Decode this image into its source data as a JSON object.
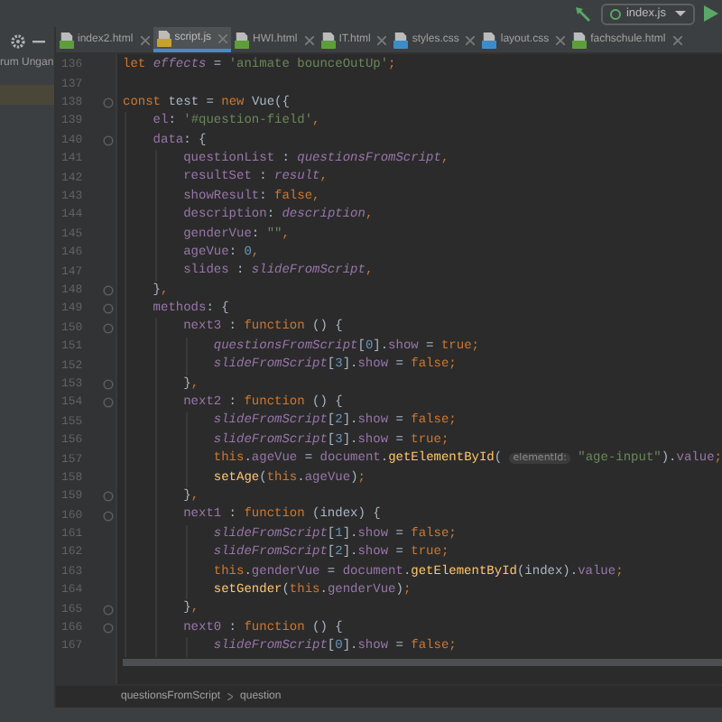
{
  "toolbar": {
    "run_config": "index.js"
  },
  "sidebar": {
    "rows": [
      {
        "label": "rum Ungan",
        "selected": false
      },
      {
        "selected": true
      }
    ]
  },
  "tabs": [
    {
      "label": "index2.html",
      "kind": "html",
      "selected": false
    },
    {
      "label": "script.js",
      "kind": "js",
      "selected": true
    },
    {
      "label": "HWI.html",
      "kind": "html",
      "selected": false
    },
    {
      "label": "IT.html",
      "kind": "html",
      "selected": false
    },
    {
      "label": "styles.css",
      "kind": "css",
      "selected": false
    },
    {
      "label": "layout.css",
      "kind": "css",
      "selected": false
    },
    {
      "label": "fachschule.html",
      "kind": "html",
      "selected": false
    }
  ],
  "editor": {
    "lines": [
      {
        "number": "136",
        "fold": false,
        "tokens": [
          {
            "kind": "kw",
            "text": "let "
          },
          {
            "kind": "gvar",
            "text": "effects"
          },
          {
            "kind": "plain",
            "text": " = "
          },
          {
            "kind": "str",
            "text": "'animate bounceOutUp'"
          },
          {
            "kind": "kw",
            "text": ";"
          }
        ]
      },
      {
        "number": "137",
        "fold": false
      },
      {
        "number": "138",
        "fold": true,
        "tokens": [
          {
            "kind": "kw",
            "text": "const "
          },
          {
            "kind": "plain",
            "text": "test = "
          },
          {
            "kind": "kw",
            "text": "new "
          },
          {
            "kind": "plain",
            "text": "Vue({"
          }
        ]
      },
      {
        "number": "139",
        "fold": false,
        "tokens": [
          {
            "kind": "field",
            "text": "    el"
          },
          {
            "kind": "plain",
            "text": ": "
          },
          {
            "kind": "str",
            "text": "'#question-field'"
          },
          {
            "kind": "kw",
            "text": ","
          }
        ]
      },
      {
        "number": "140",
        "fold": true,
        "tokens": [
          {
            "kind": "field",
            "text": "    data"
          },
          {
            "kind": "plain",
            "text": ": {"
          }
        ]
      },
      {
        "number": "141",
        "fold": false,
        "tokens": [
          {
            "kind": "field",
            "text": "        questionList"
          },
          {
            "kind": "plain",
            "text": " : "
          },
          {
            "kind": "gvar",
            "text": "questionsFromScript"
          },
          {
            "kind": "kw",
            "text": ","
          }
        ]
      },
      {
        "number": "142",
        "fold": false,
        "tokens": [
          {
            "kind": "field",
            "text": "        resultSet"
          },
          {
            "kind": "plain",
            "text": " : "
          },
          {
            "kind": "gvar",
            "text": "result"
          },
          {
            "kind": "kw",
            "text": ","
          }
        ]
      },
      {
        "number": "143",
        "fold": false,
        "tokens": [
          {
            "kind": "field",
            "text": "        showResult"
          },
          {
            "kind": "plain",
            "text": ": "
          },
          {
            "kind": "kw",
            "text": "false,"
          }
        ]
      },
      {
        "number": "144",
        "fold": false,
        "tokens": [
          {
            "kind": "field",
            "text": "        description"
          },
          {
            "kind": "plain",
            "text": ": "
          },
          {
            "kind": "gvar",
            "text": "description"
          },
          {
            "kind": "kw",
            "text": ","
          }
        ]
      },
      {
        "number": "145",
        "fold": false,
        "tokens": [
          {
            "kind": "field",
            "text": "        genderVue"
          },
          {
            "kind": "plain",
            "text": ": "
          },
          {
            "kind": "str",
            "text": "\"\""
          },
          {
            "kind": "kw",
            "text": ","
          }
        ]
      },
      {
        "number": "146",
        "fold": false,
        "tokens": [
          {
            "kind": "field",
            "text": "        ageVue"
          },
          {
            "kind": "plain",
            "text": ": "
          },
          {
            "kind": "num",
            "text": "0"
          },
          {
            "kind": "kw",
            "text": ","
          }
        ]
      },
      {
        "number": "147",
        "fold": false,
        "tokens": [
          {
            "kind": "field",
            "text": "        slides"
          },
          {
            "kind": "plain",
            "text": " : "
          },
          {
            "kind": "gvar",
            "text": "slideFromScript"
          },
          {
            "kind": "kw",
            "text": ","
          }
        ]
      },
      {
        "number": "148",
        "fold": true,
        "tokens": [
          {
            "kind": "plain",
            "text": "    }"
          },
          {
            "kind": "kw",
            "text": ","
          }
        ]
      },
      {
        "number": "149",
        "fold": true,
        "tokens": [
          {
            "kind": "field",
            "text": "    methods"
          },
          {
            "kind": "plain",
            "text": ": {"
          }
        ]
      },
      {
        "number": "150",
        "fold": true,
        "tokens": [
          {
            "kind": "field",
            "text": "        next3"
          },
          {
            "kind": "plain",
            "text": " : "
          },
          {
            "kind": "kw",
            "text": "function "
          },
          {
            "kind": "plain",
            "text": "() {"
          }
        ]
      },
      {
        "number": "151",
        "fold": false,
        "tokens": [
          {
            "kind": "gvar",
            "text": "            questionsFromScript"
          },
          {
            "kind": "plain",
            "text": "["
          },
          {
            "kind": "num",
            "text": "0"
          },
          {
            "kind": "plain",
            "text": "]."
          },
          {
            "kind": "field",
            "text": "show"
          },
          {
            "kind": "plain",
            "text": " = "
          },
          {
            "kind": "kw",
            "text": "true;"
          }
        ]
      },
      {
        "number": "152",
        "fold": false,
        "tokens": [
          {
            "kind": "gvar",
            "text": "            slideFromScript"
          },
          {
            "kind": "plain",
            "text": "["
          },
          {
            "kind": "num",
            "text": "3"
          },
          {
            "kind": "plain",
            "text": "]."
          },
          {
            "kind": "field",
            "text": "show"
          },
          {
            "kind": "plain",
            "text": " = "
          },
          {
            "kind": "kw",
            "text": "false;"
          }
        ]
      },
      {
        "number": "153",
        "fold": true,
        "tokens": [
          {
            "kind": "plain",
            "text": "        }"
          },
          {
            "kind": "kw",
            "text": ","
          }
        ]
      },
      {
        "number": "154",
        "fold": true,
        "tokens": [
          {
            "kind": "field",
            "text": "        next2"
          },
          {
            "kind": "plain",
            "text": " : "
          },
          {
            "kind": "kw",
            "text": "function "
          },
          {
            "kind": "plain",
            "text": "() {"
          }
        ]
      },
      {
        "number": "155",
        "fold": false,
        "tokens": [
          {
            "kind": "gvar",
            "text": "            slideFromScript"
          },
          {
            "kind": "plain",
            "text": "["
          },
          {
            "kind": "num",
            "text": "2"
          },
          {
            "kind": "plain",
            "text": "]."
          },
          {
            "kind": "field",
            "text": "show"
          },
          {
            "kind": "plain",
            "text": " = "
          },
          {
            "kind": "kw",
            "text": "false;"
          }
        ]
      },
      {
        "number": "156",
        "fold": false,
        "tokens": [
          {
            "kind": "gvar",
            "text": "            slideFromScript"
          },
          {
            "kind": "plain",
            "text": "["
          },
          {
            "kind": "num",
            "text": "3"
          },
          {
            "kind": "plain",
            "text": "]."
          },
          {
            "kind": "field",
            "text": "show"
          },
          {
            "kind": "plain",
            "text": " = "
          },
          {
            "kind": "kw",
            "text": "true;"
          }
        ]
      },
      {
        "number": "157",
        "fold": false,
        "tokens": [
          {
            "kind": "kw",
            "text": "            this"
          },
          {
            "kind": "plain",
            "text": "."
          },
          {
            "kind": "field",
            "text": "ageVue"
          },
          {
            "kind": "plain",
            "text": " = "
          },
          {
            "kind": "field",
            "text": "document"
          },
          {
            "kind": "plain",
            "text": "."
          },
          {
            "kind": "fn",
            "text": "getElementById"
          },
          {
            "kind": "plain",
            "text": "( "
          },
          {
            "kind": "hint",
            "text": "elementId:"
          },
          {
            "kind": "str",
            "text": " \"age-input\""
          },
          {
            "kind": "plain",
            "text": ")."
          },
          {
            "kind": "field",
            "text": "value"
          },
          {
            "kind": "kw",
            "text": ";"
          }
        ]
      },
      {
        "number": "158",
        "fold": false,
        "tokens": [
          {
            "kind": "fn",
            "text": "            setAge"
          },
          {
            "kind": "plain",
            "text": "("
          },
          {
            "kind": "kw",
            "text": "this"
          },
          {
            "kind": "plain",
            "text": "."
          },
          {
            "kind": "field",
            "text": "ageVue"
          },
          {
            "kind": "plain",
            "text": ")"
          },
          {
            "kind": "kw",
            "text": ";"
          }
        ]
      },
      {
        "number": "159",
        "fold": true,
        "tokens": [
          {
            "kind": "plain",
            "text": "        }"
          },
          {
            "kind": "kw",
            "text": ","
          }
        ]
      },
      {
        "number": "160",
        "fold": true,
        "tokens": [
          {
            "kind": "field",
            "text": "        next1"
          },
          {
            "kind": "plain",
            "text": " : "
          },
          {
            "kind": "kw",
            "text": "function "
          },
          {
            "kind": "plain",
            "text": "(index) {"
          }
        ]
      },
      {
        "number": "161",
        "fold": false,
        "tokens": [
          {
            "kind": "gvar",
            "text": "            slideFromScript"
          },
          {
            "kind": "plain",
            "text": "["
          },
          {
            "kind": "num",
            "text": "1"
          },
          {
            "kind": "plain",
            "text": "]."
          },
          {
            "kind": "field",
            "text": "show"
          },
          {
            "kind": "plain",
            "text": " = "
          },
          {
            "kind": "kw",
            "text": "false;"
          }
        ]
      },
      {
        "number": "162",
        "fold": false,
        "tokens": [
          {
            "kind": "gvar",
            "text": "            slideFromScript"
          },
          {
            "kind": "plain",
            "text": "["
          },
          {
            "kind": "num",
            "text": "2"
          },
          {
            "kind": "plain",
            "text": "]."
          },
          {
            "kind": "field",
            "text": "show"
          },
          {
            "kind": "plain",
            "text": " = "
          },
          {
            "kind": "kw",
            "text": "true;"
          }
        ]
      },
      {
        "number": "163",
        "fold": false,
        "tokens": [
          {
            "kind": "kw",
            "text": "            this"
          },
          {
            "kind": "plain",
            "text": "."
          },
          {
            "kind": "field",
            "text": "genderVue"
          },
          {
            "kind": "plain",
            "text": " = "
          },
          {
            "kind": "field",
            "text": "document"
          },
          {
            "kind": "plain",
            "text": "."
          },
          {
            "kind": "fn",
            "text": "getElementById"
          },
          {
            "kind": "plain",
            "text": "(index)."
          },
          {
            "kind": "field",
            "text": "value"
          },
          {
            "kind": "kw",
            "text": ";"
          }
        ]
      },
      {
        "number": "164",
        "fold": false,
        "tokens": [
          {
            "kind": "fn",
            "text": "            setGender"
          },
          {
            "kind": "plain",
            "text": "("
          },
          {
            "kind": "kw",
            "text": "this"
          },
          {
            "kind": "plain",
            "text": "."
          },
          {
            "kind": "field",
            "text": "genderVue"
          },
          {
            "kind": "plain",
            "text": ")"
          },
          {
            "kind": "kw",
            "text": ";"
          }
        ]
      },
      {
        "number": "165",
        "fold": true,
        "tokens": [
          {
            "kind": "plain",
            "text": "        }"
          },
          {
            "kind": "kw",
            "text": ","
          }
        ]
      },
      {
        "number": "166",
        "fold": true,
        "tokens": [
          {
            "kind": "field",
            "text": "        next0"
          },
          {
            "kind": "plain",
            "text": " : "
          },
          {
            "kind": "kw",
            "text": "function "
          },
          {
            "kind": "plain",
            "text": "() {"
          }
        ]
      },
      {
        "number": "167",
        "fold": false,
        "tokens": [
          {
            "kind": "gvar",
            "text": "            slideFromScript"
          },
          {
            "kind": "plain",
            "text": "["
          },
          {
            "kind": "num",
            "text": "0"
          },
          {
            "kind": "plain",
            "text": "]."
          },
          {
            "kind": "field",
            "text": "show"
          },
          {
            "kind": "plain",
            "text": " = "
          },
          {
            "kind": "kw",
            "text": "false;"
          }
        ]
      }
    ]
  },
  "breadcrumbs": [
    "questionsFromScript",
    "question"
  ]
}
